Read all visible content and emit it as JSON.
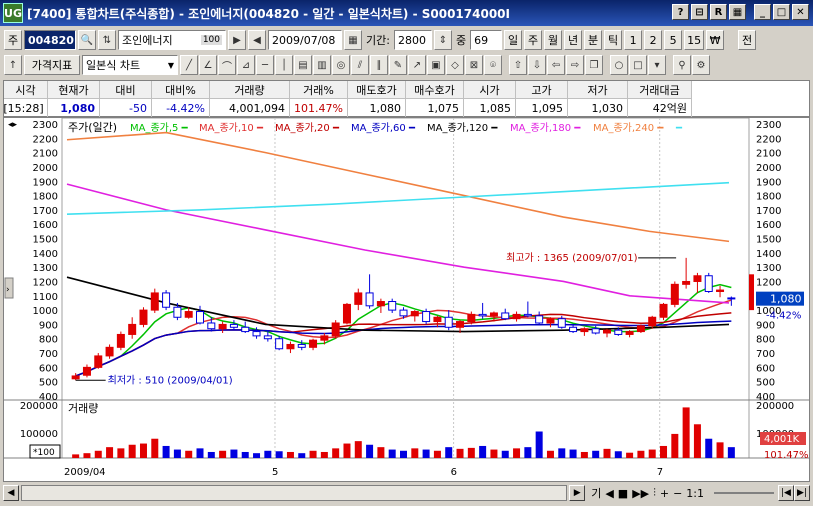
{
  "window": {
    "app_icon": "UG",
    "title": "[7400] 통합차트(주식종합) - 조인에너지(004820 - 일간 - 일본식차트) - S000174000I",
    "buttons": [
      "?",
      "⊟",
      "R",
      "▦",
      "_",
      "□",
      "✕"
    ]
  },
  "toolbar1": {
    "market_code": "주",
    "stock_code": "004820",
    "stock_name": "조인에너지",
    "stock_badge": "100",
    "date": "2009/07/08",
    "period_label": "기간:",
    "period_value": "2800",
    "count_label": "중",
    "count_value": "69",
    "period_types": [
      "일",
      "주",
      "월",
      "년",
      "분",
      "틱",
      "1",
      "2",
      "5",
      "15",
      "₩"
    ],
    "right_btn": "전"
  },
  "toolbar2": {
    "indicator_btn": "가격지표",
    "chart_type": "일본식 차트",
    "tool_icons": [
      "line-icon",
      "angle-line-icon",
      "arc-icon",
      "fan-icon",
      "hline-icon",
      "vline-icon",
      "grid-icon",
      "fib-icon",
      "cycle-icon",
      "channel-icon",
      "parallel-icon",
      "pen-icon",
      "arrow-icon",
      "color-icon",
      "eraser-icon",
      "delete-icon",
      "magnet-icon",
      "up-arrow-icon",
      "down-arrow-icon",
      "left-arrow-icon",
      "right-arrow-icon",
      "copy-icon",
      "circle-icon",
      "square-icon",
      "dropdown-icon",
      "zoom-icon",
      "settings-icon"
    ]
  },
  "quote": {
    "headers": [
      "시각",
      "현재가",
      "대비",
      "대비%",
      "거래량",
      "거래%",
      "매도호가",
      "매수호가",
      "시가",
      "고가",
      "저가",
      "거래대금"
    ],
    "values": [
      "[15:28]",
      "1,080",
      "-50",
      "-4.42%",
      "4,001,094",
      "101.47%",
      "1,080",
      "1,075",
      "1,085",
      "1,095",
      "1,030",
      "42억원"
    ]
  },
  "chart_data": {
    "type": "candlestick",
    "title": "주가(일간)",
    "legend": [
      {
        "name": "MA_종가,5",
        "color": "#00c000"
      },
      {
        "name": "MA_종가,10",
        "color": "#e03030"
      },
      {
        "name": "MA_종가,20",
        "color": "#c00000"
      },
      {
        "name": "MA_종가,60",
        "color": "#0000c0"
      },
      {
        "name": "MA_종가,120",
        "color": "#000000"
      },
      {
        "name": "MA_종가,180",
        "color": "#e020e0"
      },
      {
        "name": "MA_종가,240",
        "color": "#f08040"
      },
      {
        "name": "",
        "color": "#40e0f0"
      }
    ],
    "y_ticks": [
      2300,
      2200,
      2100,
      2000,
      1900,
      1800,
      1700,
      1600,
      1500,
      1400,
      1300,
      1200,
      1100,
      1000,
      900,
      800,
      700,
      600,
      500,
      400
    ],
    "ylim": [
      400,
      2300
    ],
    "x_labels": [
      "2009/04",
      "5",
      "6",
      "7"
    ],
    "current_price": "1,080",
    "current_change": "-4.42%",
    "annotations": {
      "high": "최고가 : 1365 (2009/07/01)",
      "low": "최저가 : 510 (2009/04/01)"
    },
    "candles": [
      {
        "o": 520,
        "h": 560,
        "l": 510,
        "c": 540
      },
      {
        "o": 545,
        "h": 620,
        "l": 530,
        "c": 600
      },
      {
        "o": 600,
        "h": 700,
        "l": 590,
        "c": 680
      },
      {
        "o": 680,
        "h": 760,
        "l": 660,
        "c": 740
      },
      {
        "o": 740,
        "h": 850,
        "l": 720,
        "c": 830
      },
      {
        "o": 830,
        "h": 950,
        "l": 800,
        "c": 900
      },
      {
        "o": 900,
        "h": 1020,
        "l": 880,
        "c": 1000
      },
      {
        "o": 1000,
        "h": 1150,
        "l": 980,
        "c": 1120
      },
      {
        "o": 1120,
        "h": 1140,
        "l": 1000,
        "c": 1020
      },
      {
        "o": 1020,
        "h": 1050,
        "l": 930,
        "c": 950
      },
      {
        "o": 950,
        "h": 1020,
        "l": 940,
        "c": 990
      },
      {
        "o": 990,
        "h": 1030,
        "l": 900,
        "c": 910
      },
      {
        "o": 910,
        "h": 950,
        "l": 850,
        "c": 870
      },
      {
        "o": 870,
        "h": 920,
        "l": 840,
        "c": 900
      },
      {
        "o": 900,
        "h": 930,
        "l": 860,
        "c": 880
      },
      {
        "o": 880,
        "h": 920,
        "l": 840,
        "c": 850
      },
      {
        "o": 850,
        "h": 880,
        "l": 800,
        "c": 820
      },
      {
        "o": 820,
        "h": 860,
        "l": 780,
        "c": 800
      },
      {
        "o": 800,
        "h": 820,
        "l": 720,
        "c": 730
      },
      {
        "o": 730,
        "h": 780,
        "l": 700,
        "c": 760
      },
      {
        "o": 760,
        "h": 790,
        "l": 720,
        "c": 740
      },
      {
        "o": 740,
        "h": 800,
        "l": 720,
        "c": 790
      },
      {
        "o": 790,
        "h": 840,
        "l": 760,
        "c": 820
      },
      {
        "o": 820,
        "h": 930,
        "l": 800,
        "c": 910
      },
      {
        "o": 910,
        "h": 1050,
        "l": 900,
        "c": 1040
      },
      {
        "o": 1040,
        "h": 1150,
        "l": 1000,
        "c": 1120
      },
      {
        "o": 1120,
        "h": 1250,
        "l": 1010,
        "c": 1030
      },
      {
        "o": 1030,
        "h": 1080,
        "l": 980,
        "c": 1060
      },
      {
        "o": 1060,
        "h": 1080,
        "l": 980,
        "c": 1000
      },
      {
        "o": 1000,
        "h": 1020,
        "l": 940,
        "c": 960
      },
      {
        "o": 960,
        "h": 1000,
        "l": 920,
        "c": 990
      },
      {
        "o": 990,
        "h": 1010,
        "l": 900,
        "c": 920
      },
      {
        "o": 920,
        "h": 960,
        "l": 880,
        "c": 950
      },
      {
        "o": 950,
        "h": 1000,
        "l": 860,
        "c": 880
      },
      {
        "o": 880,
        "h": 930,
        "l": 840,
        "c": 920
      },
      {
        "o": 920,
        "h": 990,
        "l": 900,
        "c": 970
      },
      {
        "o": 970,
        "h": 1050,
        "l": 940,
        "c": 960
      },
      {
        "o": 960,
        "h": 990,
        "l": 920,
        "c": 980
      },
      {
        "o": 980,
        "h": 1010,
        "l": 930,
        "c": 940
      },
      {
        "o": 940,
        "h": 990,
        "l": 920,
        "c": 970
      },
      {
        "o": 970,
        "h": 1060,
        "l": 950,
        "c": 960
      },
      {
        "o": 960,
        "h": 990,
        "l": 900,
        "c": 910
      },
      {
        "o": 910,
        "h": 950,
        "l": 880,
        "c": 940
      },
      {
        "o": 940,
        "h": 960,
        "l": 870,
        "c": 880
      },
      {
        "o": 880,
        "h": 900,
        "l": 840,
        "c": 850
      },
      {
        "o": 850,
        "h": 880,
        "l": 820,
        "c": 870
      },
      {
        "o": 870,
        "h": 890,
        "l": 830,
        "c": 840
      },
      {
        "o": 840,
        "h": 870,
        "l": 810,
        "c": 860
      },
      {
        "o": 860,
        "h": 880,
        "l": 820,
        "c": 830
      },
      {
        "o": 830,
        "h": 860,
        "l": 810,
        "c": 850
      },
      {
        "o": 850,
        "h": 900,
        "l": 840,
        "c": 890
      },
      {
        "o": 890,
        "h": 960,
        "l": 870,
        "c": 950
      },
      {
        "o": 950,
        "h": 1050,
        "l": 930,
        "c": 1040
      },
      {
        "o": 1040,
        "h": 1200,
        "l": 1020,
        "c": 1180
      },
      {
        "o": 1180,
        "h": 1365,
        "l": 1150,
        "c": 1200
      },
      {
        "o": 1200,
        "h": 1260,
        "l": 1120,
        "c": 1240
      },
      {
        "o": 1240,
        "h": 1260,
        "l": 1120,
        "c": 1130
      },
      {
        "o": 1130,
        "h": 1170,
        "l": 1090,
        "c": 1140
      },
      {
        "o": 1085,
        "h": 1095,
        "l": 1030,
        "c": 1080
      }
    ],
    "volume": {
      "label": "거래량",
      "y_ticks": [
        "200000",
        "100000"
      ],
      "unit": "*100",
      "current": "4,001K",
      "current_pct": "101.47%",
      "values": [
        15,
        20,
        30,
        45,
        40,
        55,
        60,
        80,
        50,
        35,
        30,
        40,
        25,
        30,
        35,
        25,
        20,
        30,
        28,
        25,
        20,
        30,
        25,
        40,
        60,
        70,
        55,
        45,
        35,
        30,
        40,
        35,
        30,
        45,
        38,
        42,
        50,
        35,
        30,
        40,
        45,
        110,
        30,
        40,
        35,
        25,
        30,
        38,
        28,
        22,
        30,
        35,
        50,
        100,
        210,
        140,
        80,
        65,
        45
      ]
    }
  },
  "bottom": {
    "zoom": "1:1"
  }
}
